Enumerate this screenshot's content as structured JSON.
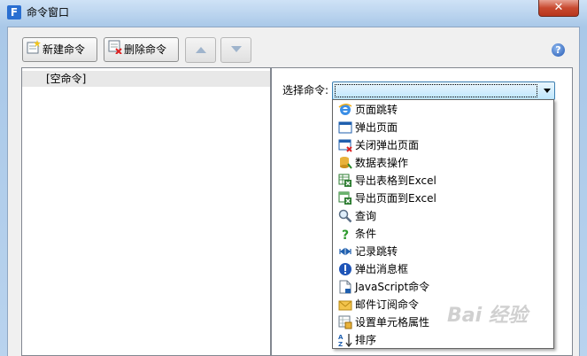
{
  "window": {
    "title": "命令窗口",
    "app_icon_letter": "F",
    "close_symbol": "✕"
  },
  "toolbar": {
    "new_label": "新建命令",
    "delete_label": "删除命令",
    "help_symbol": "?"
  },
  "tree": {
    "items": [
      {
        "label": "[空命令]"
      }
    ]
  },
  "command_select": {
    "label": "选择命令:",
    "selected": "",
    "options": [
      {
        "label": "页面跳转",
        "icon": "ie-browser-icon"
      },
      {
        "label": "弹出页面",
        "icon": "popup-window-icon"
      },
      {
        "label": "关闭弹出页面",
        "icon": "close-popup-icon"
      },
      {
        "label": "数据表操作",
        "icon": "database-icon"
      },
      {
        "label": "导出表格到Excel",
        "icon": "excel-export-icon"
      },
      {
        "label": "导出页面到Excel",
        "icon": "excel-export-page-icon"
      },
      {
        "label": "查询",
        "icon": "magnifier-icon"
      },
      {
        "label": "条件",
        "icon": "question-mark-icon"
      },
      {
        "label": "记录跳转",
        "icon": "record-navigation-icon"
      },
      {
        "label": "弹出消息框",
        "icon": "exclamation-icon"
      },
      {
        "label": "JavaScript命令",
        "icon": "script-document-icon"
      },
      {
        "label": "邮件订阅命令",
        "icon": "envelope-icon"
      },
      {
        "label": "设置单元格属性",
        "icon": "cell-properties-icon"
      },
      {
        "label": "排序",
        "icon": "sort-az-icon"
      }
    ]
  },
  "watermark": {
    "text": "Bai 经验"
  },
  "colors": {
    "accent": "#3c7fb1",
    "selection": "#e8e8e8"
  }
}
